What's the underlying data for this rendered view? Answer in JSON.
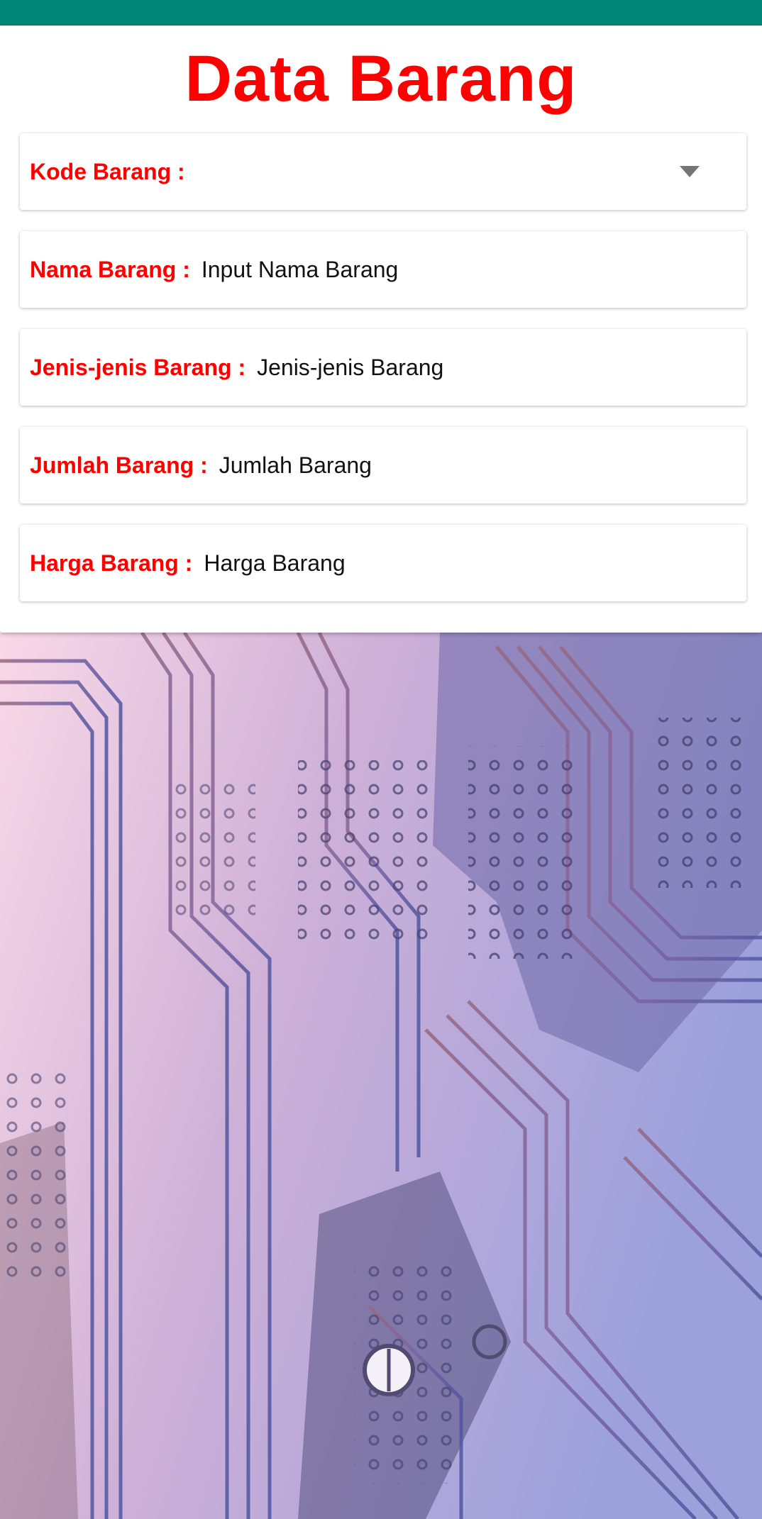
{
  "colors": {
    "status_bar": "#008577",
    "title": "#ff0000",
    "label": "#ff0000"
  },
  "header": {
    "title": "Data Barang"
  },
  "form": {
    "kode": {
      "label": "Kode Barang :",
      "value": "",
      "icon": "chevron-down-icon"
    },
    "nama": {
      "label": "Nama Barang :",
      "placeholder": "Input Nama Barang"
    },
    "jenis": {
      "label": "Jenis-jenis Barang :",
      "placeholder": "Jenis-jenis Barang"
    },
    "jumlah": {
      "label": "Jumlah Barang :",
      "placeholder": "Jumlah Barang"
    },
    "harga": {
      "label": "Harga Barang :",
      "placeholder": "Harga Barang"
    }
  },
  "background": {
    "image": "circuit-board-image",
    "gradient_start": "#f6c7dd",
    "gradient_end": "#5a62b8"
  }
}
